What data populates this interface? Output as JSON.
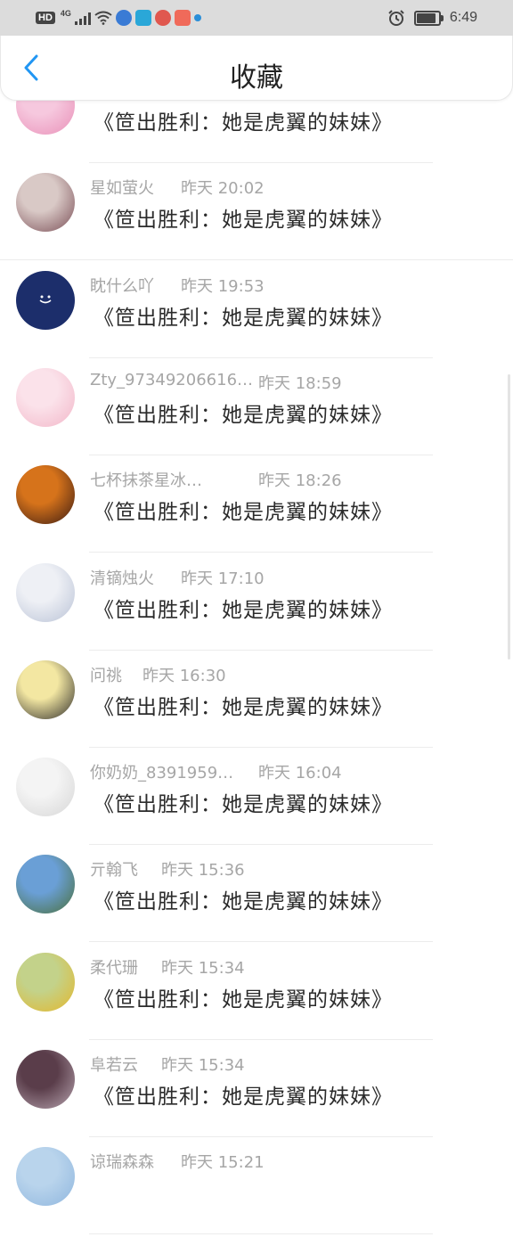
{
  "status_bar": {
    "hd": "HD",
    "network": "4G",
    "time": "6:49",
    "app_icon_colors": [
      "#3a7bd5",
      "#2aa7d8",
      "#e0584f",
      "#f06a5a",
      "#2a8ed8"
    ]
  },
  "header": {
    "title": "收藏",
    "back_icon": "chevron-left-icon",
    "accent": "#2196f3"
  },
  "favorites": [
    {
      "user": "",
      "time": "",
      "title": "《笸出胜利：她是虎翼的妹妹》",
      "avatar_colors": [
        "#f6c8de",
        "#e990b8"
      ]
    },
    {
      "user": "星如萤火",
      "time": "昨天 20:02",
      "title": "《笸出胜利：她是虎翼的妹妹》",
      "avatar_colors": [
        "#d9c9c6",
        "#7a4e56"
      ]
    },
    {
      "user": "眈什么吖",
      "time": "昨天 19:53",
      "title": "《笸出胜利：她是虎翼的妹妹》",
      "avatar_colors": [
        "#1c2e6b",
        "#1c2e6b"
      ]
    },
    {
      "user": "Zty_97349206616…",
      "time": "昨天 18:59",
      "title": "《笸出胜利：她是虎翼的妹妹》",
      "avatar_colors": [
        "#fbe2ea",
        "#f2b6c8"
      ]
    },
    {
      "user": "七杯抹茶星冰…",
      "time": "昨天 18:26",
      "title": "《笸出胜利：她是虎翼的妹妹》",
      "avatar_colors": [
        "#d6731b",
        "#3b1b12"
      ]
    },
    {
      "user": "清镝烛火",
      "time": "昨天 17:10",
      "title": "《笸出胜利：她是虎翼的妹妹》",
      "avatar_colors": [
        "#eef0f5",
        "#b9c2d6"
      ]
    },
    {
      "user": "问祧",
      "time": "昨天 16:30",
      "title": "《笸出胜利：她是虎翼的妹妹》",
      "avatar_colors": [
        "#f3e7a2",
        "#2d2b2a"
      ]
    },
    {
      "user": "你奶奶_8391959…",
      "time": "昨天 16:04",
      "title": "《笸出胜利：她是虎翼的妹妹》",
      "avatar_colors": [
        "#f4f4f4",
        "#d6d6d6"
      ]
    },
    {
      "user": "亓翰飞",
      "time": "昨天 15:36",
      "title": "《笸出胜利：她是虎翼的妹妹》",
      "avatar_colors": [
        "#6a9fd6",
        "#4a6f3a"
      ]
    },
    {
      "user": "柔代珊",
      "time": "昨天 15:34",
      "title": "《笸出胜利：她是虎翼的妹妹》",
      "avatar_colors": [
        "#c3d28a",
        "#e4b72c"
      ]
    },
    {
      "user": "阜若云",
      "time": "昨天 15:34",
      "title": "《笸出胜利：她是虎翼的妹妹》",
      "avatar_colors": [
        "#5a3d4a",
        "#b8a5b0"
      ]
    },
    {
      "user": "谅瑞森森",
      "time": "昨天 15:21",
      "title": "",
      "avatar_colors": [
        "#b9d4ec",
        "#8fb6de"
      ]
    }
  ]
}
